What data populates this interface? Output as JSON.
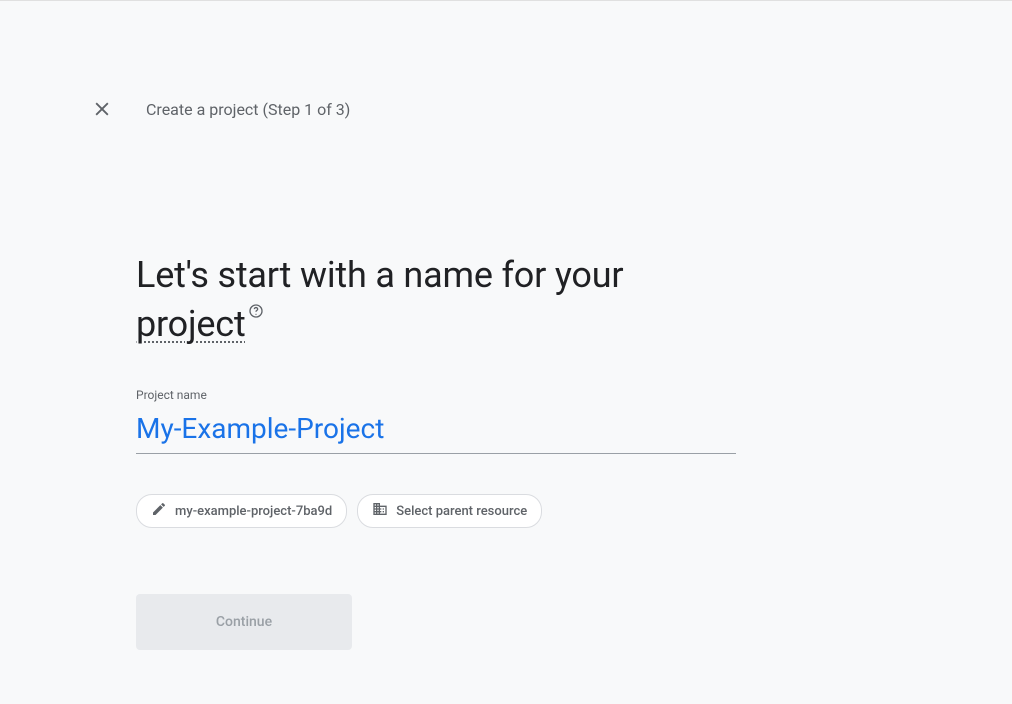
{
  "header": {
    "step_title": "Create a project (Step 1 of 3)"
  },
  "main": {
    "heading_prefix": "Let's start with a name for your ",
    "heading_underlined": "project",
    "field_label": "Project name",
    "field_value": "My-Example-Project",
    "chips": {
      "project_id": "my-example-project-7ba9d",
      "parent_resource": "Select parent resource"
    },
    "continue_label": "Continue"
  }
}
